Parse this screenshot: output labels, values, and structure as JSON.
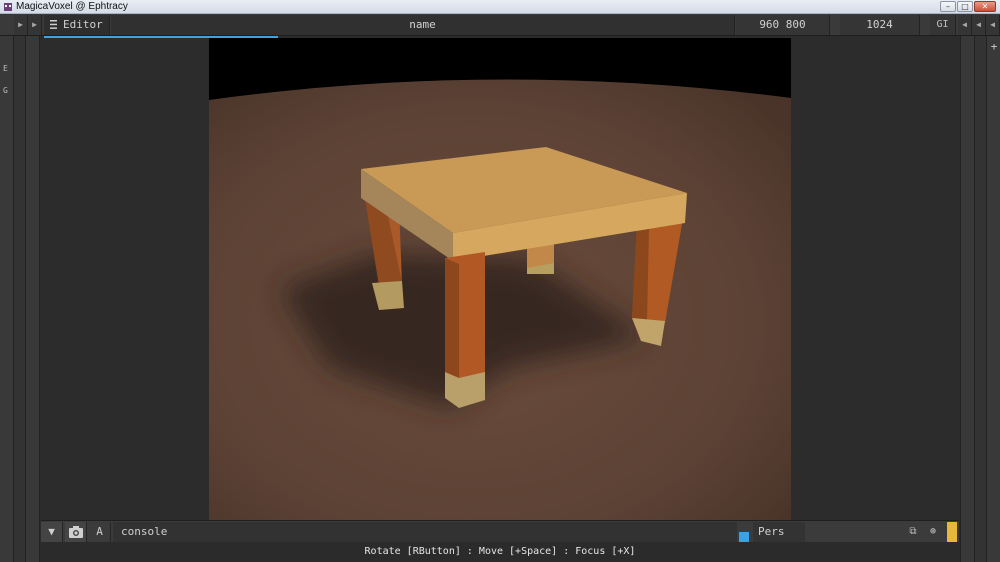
{
  "window": {
    "title": "MagicaVoxel @ Ephtracy"
  },
  "toolbar": {
    "editor_label": "Editor",
    "name_field": "name",
    "render_size": "960 800",
    "sample_count": "1024",
    "gi_label": "GI"
  },
  "left_rail": {
    "letters": [
      "E",
      "G"
    ]
  },
  "right_rail": {
    "plus_label": "+"
  },
  "bottom": {
    "collapse_glyph": "▼",
    "a_label": "A",
    "console_text": "console",
    "projection": "Pers"
  },
  "status": {
    "hint": "Rotate [RButton] : Move [+Space] : Focus [+X]"
  },
  "colors": {
    "accent_blue": "#3ca2e0",
    "accent_yellow": "#e6b93c",
    "table_top": "#c99a55",
    "table_leg": "#a85a2a",
    "ground": "#5e4438"
  },
  "icons": [
    "camera-icon",
    "menu-icon",
    "arrow-right-icon",
    "arrow-left-icon"
  ]
}
